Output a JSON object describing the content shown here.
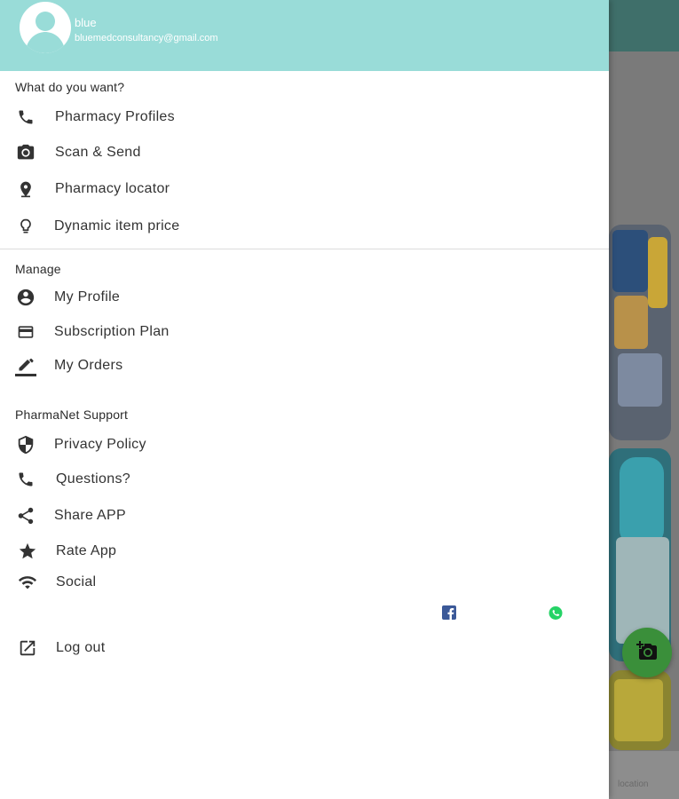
{
  "header": {
    "user_name": "blue",
    "user_email": "bluemedconsultancy@gmail.com"
  },
  "sections": {
    "want": {
      "title": "What do you want?",
      "items": [
        {
          "label": "Pharmacy Profiles",
          "icon": "phone-icon"
        },
        {
          "label": "Scan & Send",
          "icon": "camera-icon"
        },
        {
          "label": "Pharmacy locator",
          "icon": "location-pin-icon"
        },
        {
          "label": "Dynamic item price",
          "icon": "lightbulb-icon"
        }
      ]
    },
    "manage": {
      "title": "Manage",
      "items": [
        {
          "label": "My Profile",
          "icon": "account-circle-icon"
        },
        {
          "label": "Subscription Plan",
          "icon": "credit-card-icon"
        },
        {
          "label": "My Orders",
          "icon": "edit-pencil-icon"
        }
      ]
    },
    "support": {
      "title": "PharmaNet Support",
      "items": [
        {
          "label": "Privacy Policy",
          "icon": "shield-icon"
        },
        {
          "label": "Questions?",
          "icon": "phone-icon"
        },
        {
          "label": "Share APP",
          "icon": "share-icon"
        },
        {
          "label": "Rate App",
          "icon": "star-icon"
        },
        {
          "label": "Social",
          "icon": "wifi-icon"
        }
      ]
    }
  },
  "social_links": [
    {
      "icon": "facebook-icon",
      "color": "#3b5998"
    },
    {
      "icon": "whatsapp-icon",
      "color": "#25d366"
    }
  ],
  "logout": {
    "label": "Log out",
    "icon": "open-external-icon"
  },
  "background": {
    "bottom_nav_label": "location",
    "fab_icon": "add-camera-icon",
    "appbar_color": "#3f6f6a",
    "fab_color": "#3a8f3a"
  },
  "colors": {
    "header": "#99dcd8",
    "text": "#333333",
    "icon": "#333333"
  }
}
